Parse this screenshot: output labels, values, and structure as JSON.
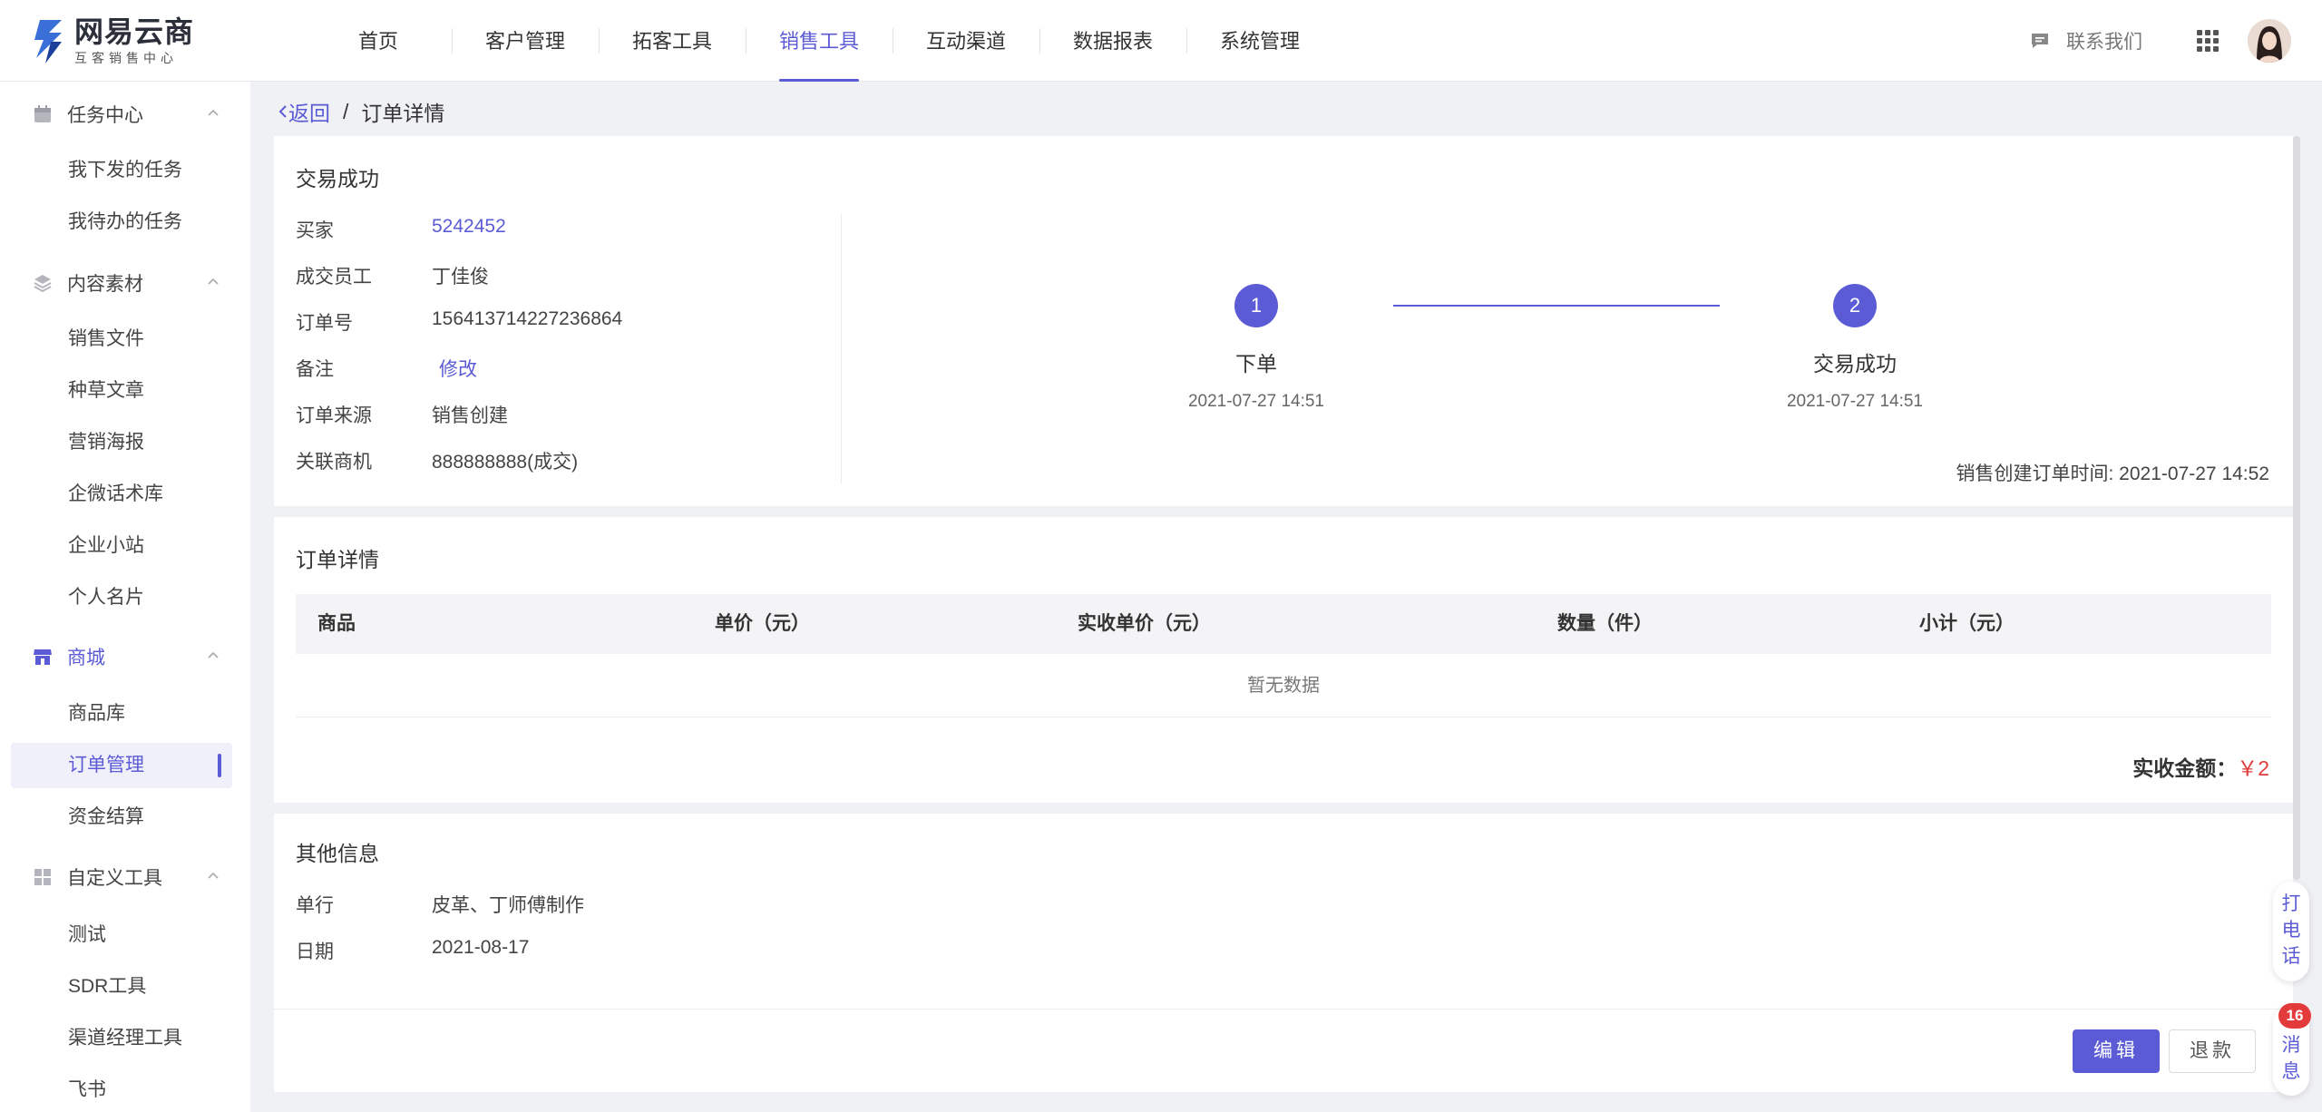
{
  "brand": {
    "name": "网易云商",
    "tagline": "互客销售中心"
  },
  "nav": {
    "items": [
      {
        "label": "首页",
        "active": false
      },
      {
        "label": "客户管理",
        "active": false
      },
      {
        "label": "拓客工具",
        "active": false
      },
      {
        "label": "销售工具",
        "active": true
      },
      {
        "label": "互动渠道",
        "active": false
      },
      {
        "label": "数据报表",
        "active": false
      },
      {
        "label": "系统管理",
        "active": false
      }
    ],
    "contact": "联系我们"
  },
  "sidebar": {
    "groups": [
      {
        "label": "任务中心",
        "icon": "calendar-icon",
        "items": [
          "我下发的任务",
          "我待办的任务"
        ]
      },
      {
        "label": "内容素材",
        "icon": "layers-icon",
        "items": [
          "销售文件",
          "种草文章",
          "营销海报",
          "企微话术库",
          "企业小站",
          "个人名片"
        ]
      },
      {
        "label": "商城",
        "icon": "store-icon",
        "items": [
          "商品库",
          "订单管理",
          "资金结算"
        ]
      },
      {
        "label": "自定义工具",
        "icon": "apps-icon",
        "items": [
          "测试",
          "SDR工具",
          "渠道经理工具",
          "飞书"
        ]
      }
    ],
    "active_item": "订单管理"
  },
  "breadcrumb": {
    "back": "返回",
    "separator": "/",
    "current": "订单详情"
  },
  "status": {
    "title": "交易成功",
    "fields": [
      {
        "label": "买家",
        "value": "5242452",
        "link": true
      },
      {
        "label": "成交员工",
        "value": "丁佳俊",
        "link": false
      },
      {
        "label": "订单号",
        "value": "156413714227236864",
        "link": false
      },
      {
        "label": "备注",
        "value": "修改",
        "link": true
      },
      {
        "label": "订单来源",
        "value": "销售创建",
        "link": false
      },
      {
        "label": "关联商机",
        "value": "888888888(成交)",
        "link": false
      }
    ],
    "steps": [
      {
        "number": "1",
        "label": "下单",
        "time": "2021-07-27 14:51"
      },
      {
        "number": "2",
        "label": "交易成功",
        "time": "2021-07-27 14:51"
      }
    ],
    "created_time": "销售创建订单时间: 2021-07-27 14:52"
  },
  "order_detail": {
    "title": "订单详情",
    "columns": [
      "商品",
      "单价（元）",
      "实收单价（元）",
      "数量（件）",
      "小计（元）"
    ],
    "empty_text": "暂无数据",
    "total_label": "实收金额：",
    "total_value": "￥2"
  },
  "other_info": {
    "title": "其他信息",
    "fields": [
      {
        "label": "单行",
        "value": "皮革、丁师傅制作"
      },
      {
        "label": "日期",
        "value": "2021-08-17"
      }
    ]
  },
  "actions": {
    "edit": "编辑",
    "refund": "退款"
  },
  "floating": {
    "call": "打电话",
    "message": "消息",
    "badge": "16"
  },
  "colors": {
    "accent": "#5b5bd6",
    "danger": "#e33b3b"
  }
}
